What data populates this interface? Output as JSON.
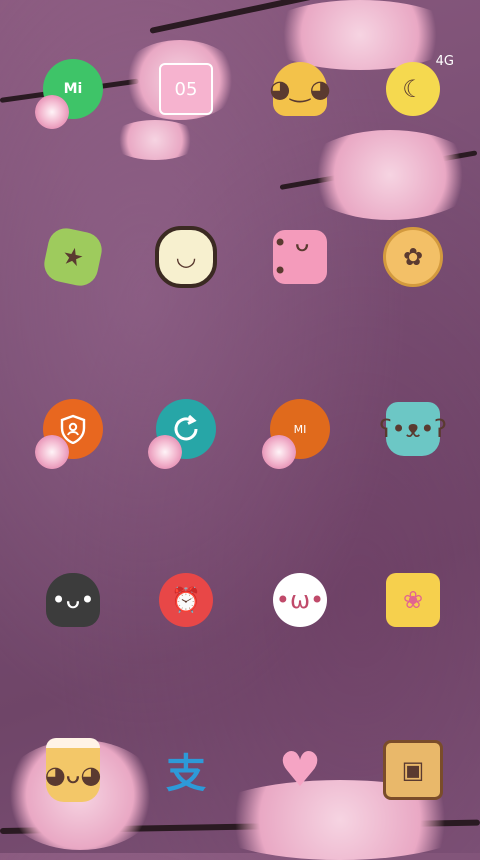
{
  "status_bar": {
    "network": "4G"
  },
  "apps": [
    {
      "name": "mi-chat-app",
      "label": "Mi",
      "icon": "mi-chat-icon"
    },
    {
      "name": "calendar-app",
      "label": "05",
      "icon": "calendar-icon"
    },
    {
      "name": "taco-app",
      "label": "",
      "icon": "taco-icon"
    },
    {
      "name": "moon-bottle-app",
      "label": "",
      "icon": "moon-bottle-icon"
    },
    {
      "name": "gift-app",
      "label": "",
      "icon": "gift-icon"
    },
    {
      "name": "sushi-roll-app",
      "label": "",
      "icon": "sushi-roll-icon"
    },
    {
      "name": "toaster-app",
      "label": "",
      "icon": "toaster-icon"
    },
    {
      "name": "pizza-app",
      "label": "",
      "icon": "pizza-icon"
    },
    {
      "name": "security-app",
      "label": "",
      "icon": "shield-icon"
    },
    {
      "name": "cleaner-app",
      "label": "",
      "icon": "refresh-icon"
    },
    {
      "name": "mi-store-app",
      "label": "MI",
      "icon": "mi-store-icon"
    },
    {
      "name": "boots-app",
      "label": "",
      "icon": "boots-icon"
    },
    {
      "name": "penguin-app",
      "label": "",
      "icon": "penguin-icon"
    },
    {
      "name": "alarm-app",
      "label": "",
      "icon": "alarm-icon"
    },
    {
      "name": "bunny-chat-app",
      "label": "",
      "icon": "bunny-chat-icon"
    },
    {
      "name": "cheese-app",
      "label": "",
      "icon": "cheese-icon"
    },
    {
      "name": "coffee-app",
      "label": "",
      "icon": "coffee-icon"
    },
    {
      "name": "alipay-app",
      "label": "支",
      "icon": "alipay-icon"
    },
    {
      "name": "heart-balloon-app",
      "label": "",
      "icon": "heart-balloon-icon"
    },
    {
      "name": "robot-app",
      "label": "",
      "icon": "robot-icon"
    }
  ]
}
